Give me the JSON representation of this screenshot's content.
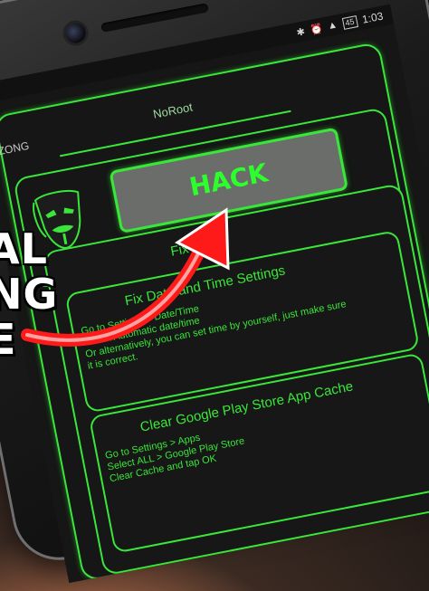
{
  "status": {
    "battery": "45",
    "time": "1:03"
  },
  "app": {
    "carrier": "ZONG",
    "title": "NoRoot",
    "hack_label": "HACK",
    "tips_title": "Fix Tipps",
    "tips": [
      {
        "heading": "Fix Date and Time Settings",
        "lines": [
          "Go to Settings > Date/Time",
          "Check Automatic date/time",
          "Or alternatively, you can set time by yourself, just make sure",
          "it is correct."
        ]
      },
      {
        "heading": "Clear Google Play Store App Cache",
        "lines": [
          "Go to Settings > Apps",
          "Select ALL > Google Play Store",
          "Clear Cache and tap OK"
        ]
      }
    ]
  },
  "overlay": {
    "lines": [
      "AL",
      "NG",
      "E"
    ]
  },
  "colors": {
    "accent": "#39e639",
    "arrow": "#ff1a1a"
  }
}
